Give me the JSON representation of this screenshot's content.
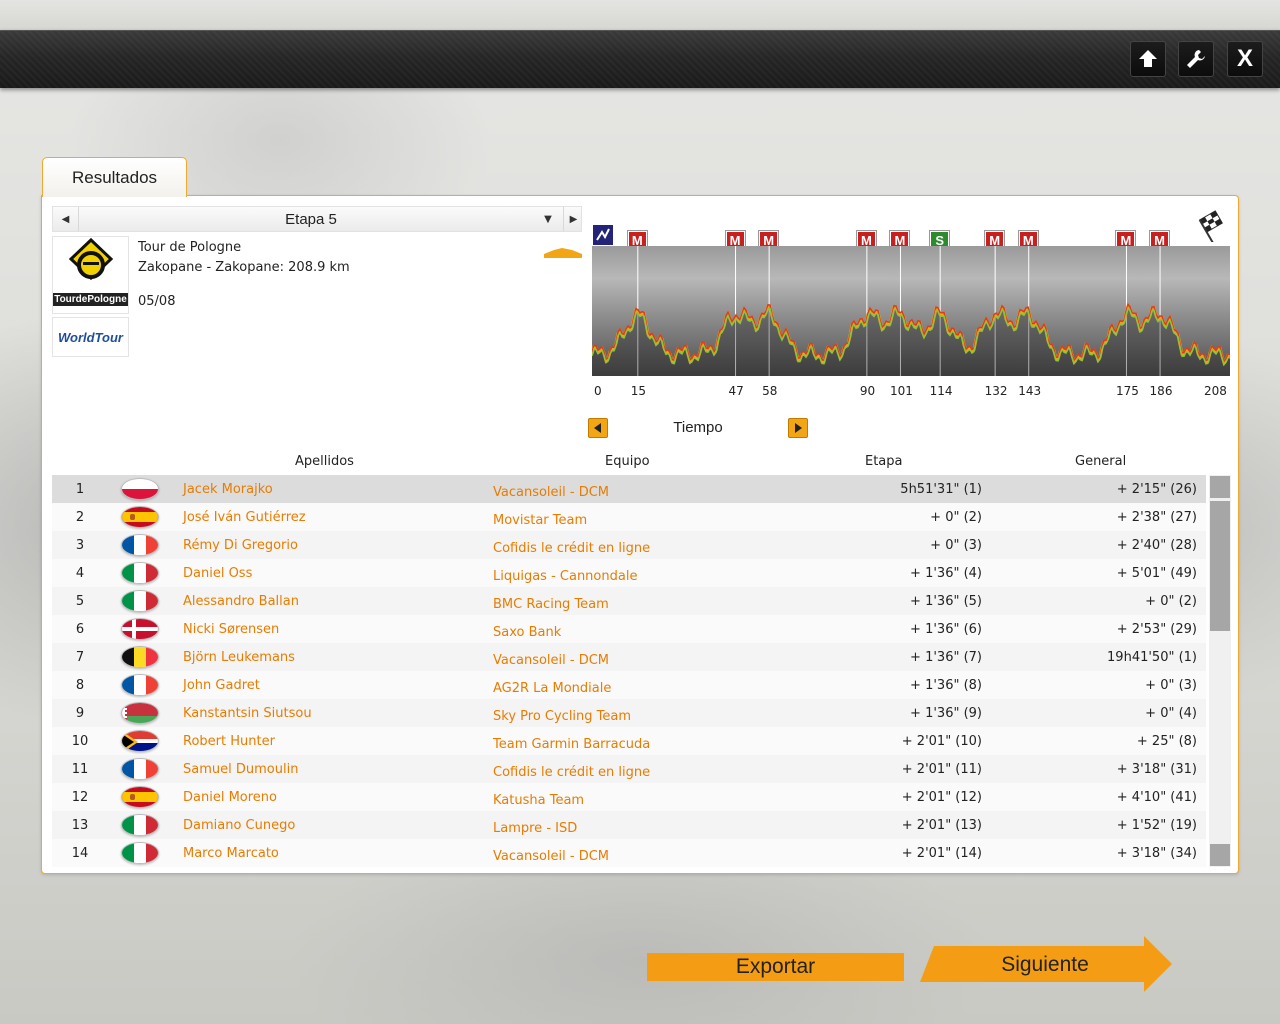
{
  "toolbar": {
    "home_icon": "home-up-arrow-icon",
    "tools_icon": "wrench-icon",
    "close_label": "X"
  },
  "tab": {
    "label": "Resultados"
  },
  "stage": {
    "label": "Etapa 5"
  },
  "race": {
    "name": "Tour de Pologne",
    "route": "Zakopane - Zakopane: 208.9 km",
    "date": "05/08",
    "logo_text": "TourdePologne",
    "tour_logo_text": "WorldTour"
  },
  "profile": {
    "markers": [
      {
        "type": "M",
        "km": 15
      },
      {
        "type": "M",
        "km": 47
      },
      {
        "type": "M",
        "km": 58
      },
      {
        "type": "M",
        "km": 90
      },
      {
        "type": "M",
        "km": 101
      },
      {
        "type": "S",
        "km": 114
      },
      {
        "type": "M",
        "km": 132
      },
      {
        "type": "M",
        "km": 143
      },
      {
        "type": "M",
        "km": 175
      },
      {
        "type": "M",
        "km": 186
      }
    ],
    "km_labels": [
      "0",
      "15",
      "47",
      "58",
      "90",
      "101",
      "114",
      "132",
      "143",
      "175",
      "186",
      "208"
    ],
    "total_km": 208.9,
    "start_icon": "stage-start-icon",
    "finish_icon": "checkered-flag-icon"
  },
  "time_selector": {
    "label": "Tiempo"
  },
  "table": {
    "headers": {
      "name": "Apellidos",
      "team": "Equipo",
      "stage": "Etapa",
      "general": "General"
    },
    "rows": [
      {
        "pos": "1",
        "flag": "poland",
        "name": "Jacek Morajko",
        "team": "Vacansoleil - DCM",
        "stage": "5h51'31\" (1)",
        "general": "+ 2'15\" (26)"
      },
      {
        "pos": "2",
        "flag": "spain",
        "name": "José Iván Gutiérrez",
        "team": "Movistar Team",
        "stage": "+ 0\" (2)",
        "general": "+ 2'38\" (27)"
      },
      {
        "pos": "3",
        "flag": "france",
        "name": "Rémy Di Gregorio",
        "team": "Cofidis le crédit en ligne",
        "stage": "+ 0\" (3)",
        "general": "+ 2'40\" (28)"
      },
      {
        "pos": "4",
        "flag": "italy",
        "name": "Daniel Oss",
        "team": "Liquigas - Cannondale",
        "stage": "+ 1'36\" (4)",
        "general": "+ 5'01\" (49)"
      },
      {
        "pos": "5",
        "flag": "italy",
        "name": "Alessandro Ballan",
        "team": "BMC Racing Team",
        "stage": "+ 1'36\" (5)",
        "general": "+ 0\" (2)"
      },
      {
        "pos": "6",
        "flag": "denmark",
        "name": "Nicki Sørensen",
        "team": "Saxo Bank",
        "stage": "+ 1'36\" (6)",
        "general": "+ 2'53\" (29)"
      },
      {
        "pos": "7",
        "flag": "belgium",
        "name": "Björn Leukemans",
        "team": "Vacansoleil - DCM",
        "stage": "+ 1'36\" (7)",
        "general": "19h41'50\" (1)"
      },
      {
        "pos": "8",
        "flag": "france",
        "name": "John Gadret",
        "team": "AG2R La Mondiale",
        "stage": "+ 1'36\" (8)",
        "general": "+ 0\" (3)"
      },
      {
        "pos": "9",
        "flag": "belarus",
        "name": "Kanstantsin Siutsou",
        "team": "Sky Pro Cycling Team",
        "stage": "+ 1'36\" (9)",
        "general": "+ 0\" (4)"
      },
      {
        "pos": "10",
        "flag": "south-africa",
        "name": "Robert Hunter",
        "team": "Team Garmin Barracuda",
        "stage": "+ 2'01\" (10)",
        "general": "+ 25\" (8)"
      },
      {
        "pos": "11",
        "flag": "france",
        "name": "Samuel Dumoulin",
        "team": "Cofidis le crédit en ligne",
        "stage": "+ 2'01\" (11)",
        "general": "+ 3'18\" (31)"
      },
      {
        "pos": "12",
        "flag": "spain",
        "name": "Daniel Moreno",
        "team": "Katusha Team",
        "stage": "+ 2'01\" (12)",
        "general": "+ 4'10\" (41)"
      },
      {
        "pos": "13",
        "flag": "italy",
        "name": "Damiano Cunego",
        "team": "Lampre - ISD",
        "stage": "+ 2'01\" (13)",
        "general": "+ 1'52\" (19)"
      },
      {
        "pos": "14",
        "flag": "italy",
        "name": "Marco Marcato",
        "team": "Vacansoleil - DCM",
        "stage": "+ 2'01\" (14)",
        "general": "+ 3'18\" (34)"
      }
    ]
  },
  "buttons": {
    "export": "Exportar",
    "next": "Siguiente"
  },
  "colors": {
    "accent": "#f49d14",
    "link": "#e87c00",
    "panel_border": "#f0a830"
  }
}
